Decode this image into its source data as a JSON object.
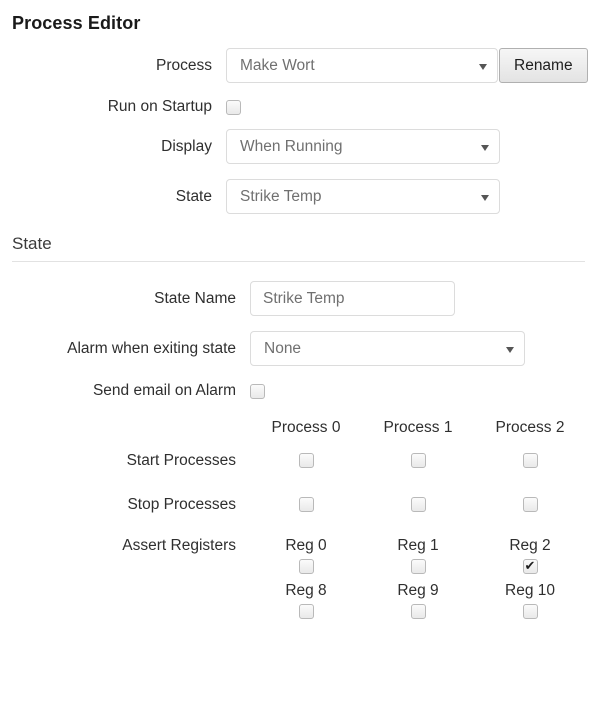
{
  "page": {
    "title": "Process Editor"
  },
  "process_section": {
    "rows": [
      {
        "label": "Process",
        "type": "select-with-button",
        "value": "Make Wort",
        "button_label": "Rename"
      },
      {
        "label": "Run on Startup",
        "type": "checkbox",
        "checked": false
      },
      {
        "label": "Display",
        "type": "select",
        "value": "When Running"
      },
      {
        "label": "State",
        "type": "select",
        "value": "Strike Temp"
      }
    ]
  },
  "state_section": {
    "header": "State",
    "state_name": {
      "label": "State Name",
      "value": "Strike Temp",
      "placeholder": "State Name"
    },
    "alarm": {
      "label": "Alarm when exiting state",
      "value": "None"
    },
    "send_email": {
      "label": "Send email on Alarm",
      "checked": false
    },
    "process_columns": [
      "Process 0",
      "Process 1",
      "Process 2"
    ],
    "start_processes": {
      "label": "Start Processes",
      "checked": [
        false,
        false,
        false
      ]
    },
    "stop_processes": {
      "label": "Stop Processes",
      "checked": [
        false,
        false,
        false
      ]
    },
    "assert_registers": {
      "label": "Assert Registers",
      "row1_labels": [
        "Reg 0",
        "Reg 1",
        "Reg 2"
      ],
      "row1_checked": [
        false,
        false,
        true
      ],
      "row2_labels": [
        "Reg 8",
        "Reg 9",
        "Reg 10"
      ],
      "row2_checked": [
        false,
        false,
        false
      ]
    }
  },
  "icons": {
    "caret": "chevron-down-icon",
    "check": "check-mark-icon"
  },
  "colors": {
    "text": "#2f2f2f",
    "muted": "#707070",
    "border": "#dcdcdc",
    "divider": "#e2e2e2",
    "button_face": "#e9e9e9"
  }
}
